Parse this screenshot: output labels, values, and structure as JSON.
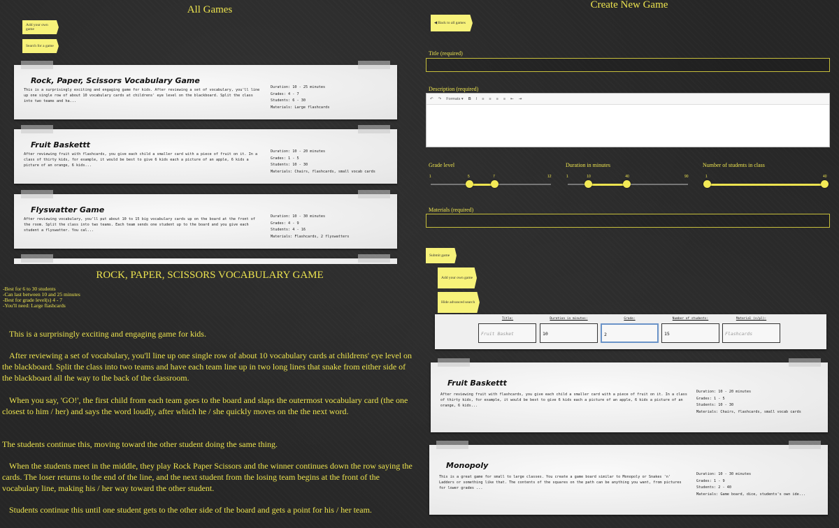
{
  "all_games": {
    "title": "All Games",
    "add_button": "Add your own game",
    "search_button": "Search for a game",
    "games": [
      {
        "title": "Rock, Paper, Scissors Vocabulary Game",
        "description": "This is a surprisingly exciting and engaging game for kids. After reviewing a set of vocabulary, you'll line up one single row of about 10 vocabulary cards at childrens' eye level on the blackboard. Split the class into two teams and ha...",
        "duration": "Duration: 10 - 25 minutes",
        "grades": "Grades: 4 - 7",
        "students": "Students: 6 - 30",
        "materials": "Materials: Large flashcards"
      },
      {
        "title": "Fruit Baskettt",
        "description": "After reviewing fruit with flashcards, you give each child a smaller card with a piece of fruit on it. In a class of thirty kids, for example, it would be best to give 6 kids each a picture of an apple, 6 kids a picture of an orange, 6 kids...",
        "duration": "Duration: 10 - 20 minutes",
        "grades": "Grades: 1 - 5",
        "students": "Students: 10 - 30",
        "materials": "Materials: Chairs, flashcards, small vocab cards"
      },
      {
        "title": "Flyswatter Game",
        "description": "After reviewing vocabulary, you'll put about 10 to 15 big vocabulary cards up on the board at the front of the room. Split the class into two teams. Each team sends one student up to the board and you give each student a flyswatter. You cal...",
        "duration": "Duration: 10 - 30 minutes",
        "grades": "Grades: 4 - 9",
        "students": "Students: 4 - 16",
        "materials": "Materials: Flashcards, 2 flyswatters"
      }
    ]
  },
  "create_game": {
    "title": "Create New Game",
    "back_button": "Back to all games",
    "title_label": "Title (required)",
    "description_label": "Description (required)",
    "toolbar": {
      "undo": "↶",
      "redo": "↷",
      "formats": "Formats ▾",
      "bold": "B",
      "italic": "I",
      "align_left": "≡",
      "align_center": "≡",
      "align_right": "≡",
      "justify": "≡",
      "outdent": "⇤",
      "indent": "⇥"
    },
    "grade_label": "Grade level",
    "grade_min": "1",
    "grade_max": "12",
    "grade_low": "5",
    "grade_high": "7",
    "grade_low_frac": 0.32,
    "grade_high_frac": 0.53,
    "duration_label": "Duration in minutes",
    "duration_min": "1",
    "duration_max": "90",
    "duration_low": "10",
    "duration_high": "40",
    "duration_low_frac": 0.17,
    "duration_high_frac": 0.49,
    "students_label": "Number of students in class",
    "students_min": "1",
    "students_max": "40",
    "students_low": "1",
    "students_high": "40",
    "students_low_frac": 0.0,
    "students_high_frac": 1.0,
    "materials_label": "Materials (required)",
    "submit_button": "Submit game"
  },
  "detail": {
    "title": "ROCK, PAPER, SCISSORS VOCABULARY GAME",
    "facts": [
      "-Best for 6 to 30 students",
      "-Can last between 10 and 25 minutes",
      "-Best for grade level(s) 4 - 7",
      "-You'll need: Large flashcards"
    ],
    "paragraphs": [
      "This is a surprisingly exciting and engaging game for kids.",
      "After reviewing a set of vocabulary, you'll line up one single row of about 10 vocabulary cards at childrens' eye level on the blackboard. Split the class into two teams and have each team line up in two long lines that snake from either side of the blackboard all the way to the back of the classroom.",
      "When you say, 'GO!', the first child from each team goes to the board and slaps the outermost vocabulary card (the one closest to him / her) and says the word loudly, after which he / she quickly moves on the the next word.",
      "The students continue this, moving toward the other student doing the same thing.",
      "When the students meet in the middle, they play Rock Paper Scissors and the winner continues down the row saying the cards. The loser returns to the end of the line, and the next student from the losing team begins at the front of the vocabulary line, making his / her way toward the other student.",
      "Students continue this until one student gets to the other side of the board and gets a point for his / her team."
    ]
  },
  "search": {
    "add_button": "Add your own game",
    "hide_button": "Hide advanced search",
    "fields": [
      {
        "label": "Title:",
        "value": "",
        "placeholder": "Fruit Basket"
      },
      {
        "label": "Duration in minutes:",
        "value": "10",
        "placeholder": ""
      },
      {
        "label": "Grade:",
        "value": "2",
        "placeholder": ""
      },
      {
        "label": "Number of students:",
        "value": "15",
        "placeholder": ""
      },
      {
        "label": "Material (s/pl):",
        "value": "",
        "placeholder": "Flashcards"
      }
    ],
    "results": [
      {
        "title": "Fruit Baskettt",
        "description": "After reviewing fruit with flashcards, you give each child a smaller card with a piece of fruit on it. In a class of thirty kids, for example, it would be best to give 6 kids each a picture of an apple, 6 kids a picture of an orange, 6 kids...",
        "duration": "Duration: 10 - 20 minutes",
        "grades": "Grades: 1 - 5",
        "students": "Students: 10 - 30",
        "materials": "Materials: Chairs, flashcards, small vocab cards"
      },
      {
        "title": "Monopoly",
        "description": "This is a great game for small to large classes. You create a game board similar to Monopoly or Snakes 'n' Ladders or something like that. The contents of the squares on the path can be anything you want, from pictures for lower grades ...",
        "duration": "Duration: 10 - 30 minutes",
        "grades": "Grades: 1 - 9",
        "students": "Students: 2 - 40",
        "materials": "Materials: Game board, dice, students's own ide..."
      }
    ]
  }
}
